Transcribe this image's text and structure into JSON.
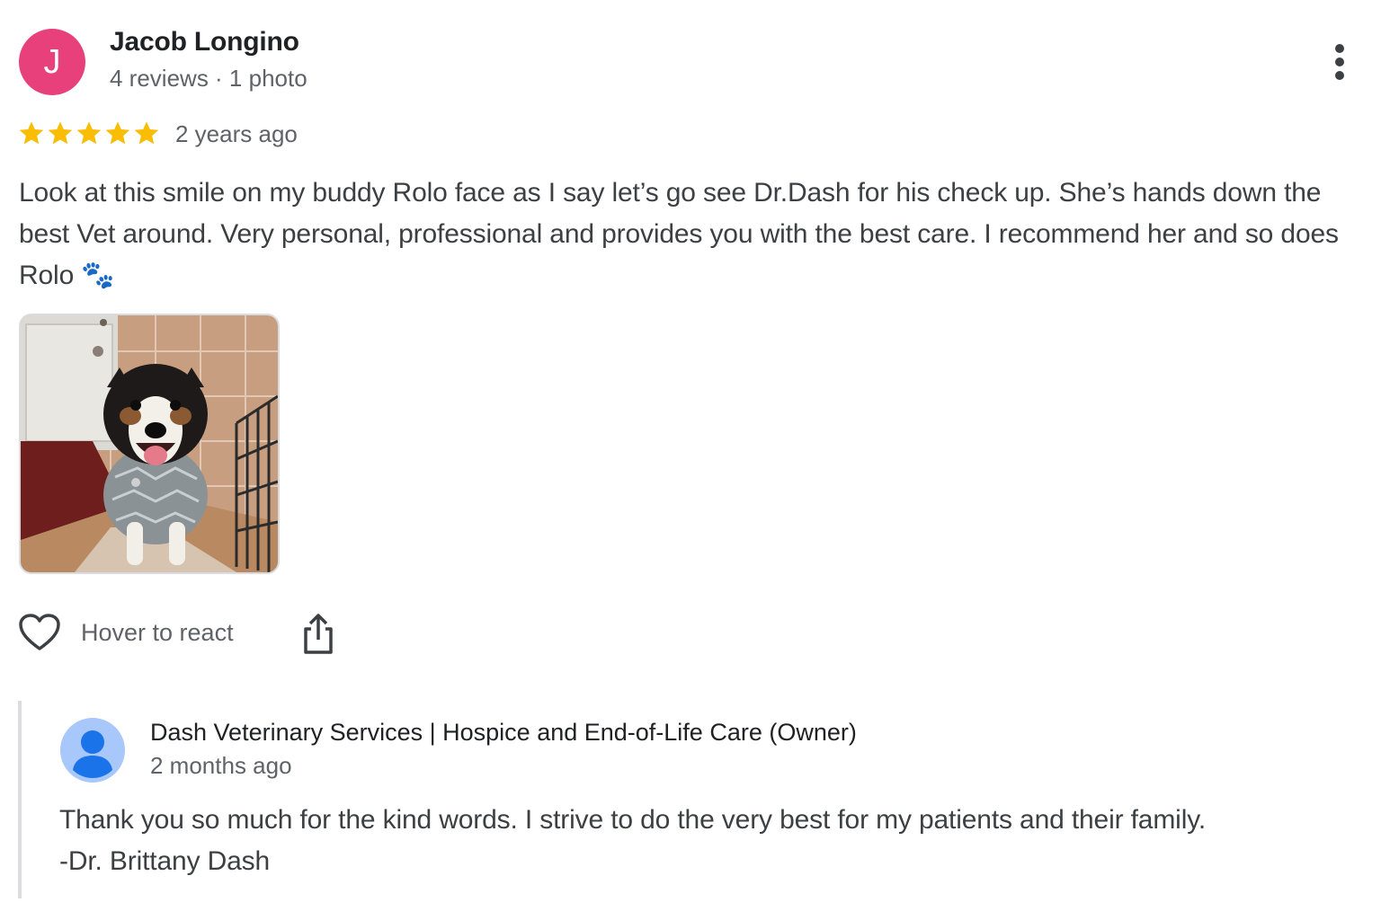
{
  "review": {
    "author": {
      "initial": "J",
      "name": "Jacob Longino",
      "meta": "4 reviews · 1 photo",
      "avatar_color": "#e8407a"
    },
    "rating": 5,
    "rating_max": 5,
    "star_color": "#fbbc04",
    "time": "2 years ago",
    "text": "Look at this smile on my buddy Rolo face as I say let’s go see Dr.Dash for his check up. She’s hands down the best Vet around. Very personal, professional and provides you with the best care. I recommend her and so does Rolo 🐾",
    "photo_icon": "dog-photo",
    "actions": {
      "react_label": "Hover to react",
      "react_icon": "heart-outline-icon",
      "share_icon": "share-icon",
      "more_icon": "more-vertical-icon"
    }
  },
  "owner_response": {
    "name": "Dash Veterinary Services | Hospice and End-of-Life Care (Owner)",
    "time": "2 months ago",
    "text_line1": "Thank you so much for the kind words. I strive to do the very best for my patients and their family.",
    "text_line2": "-Dr. Brittany Dash",
    "avatar_icon": "default-person-avatar",
    "border_color": "#dadce0"
  }
}
